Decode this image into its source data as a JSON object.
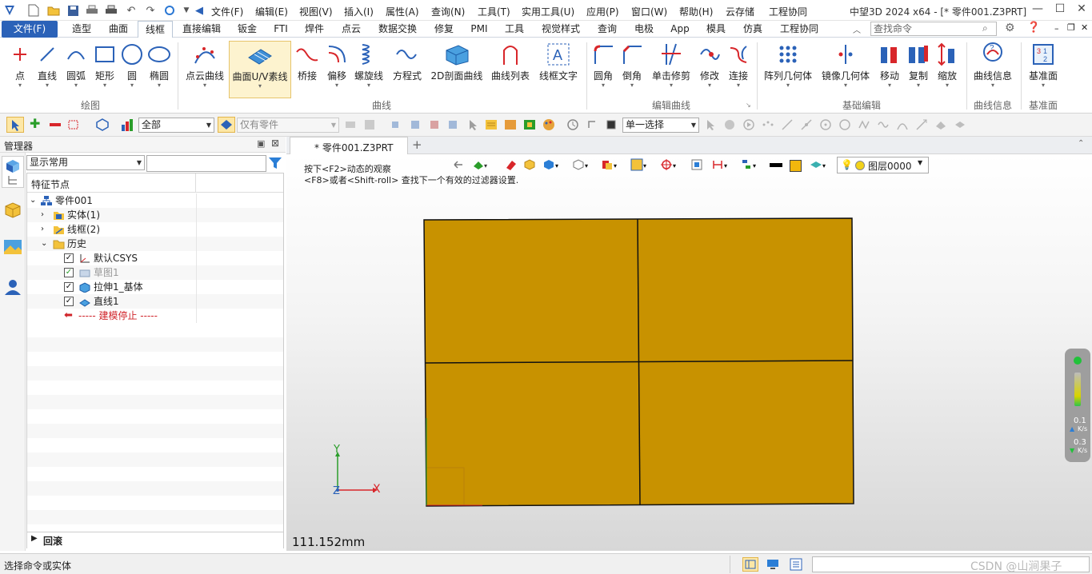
{
  "title": {
    "text": "中望3D 2024 x64 - [* 零件001.Z3PRT]",
    "menu": [
      "文件(F)",
      "编辑(E)",
      "视图(V)",
      "插入(I)",
      "属性(A)",
      "查询(N)",
      "工具(T)",
      "实用工具(U)",
      "应用(P)",
      "窗口(W)",
      "帮助(H)",
      "云存储",
      "工程协同"
    ]
  },
  "tabs": [
    "文件(F)",
    "造型",
    "曲面",
    "线框",
    "直接编辑",
    "钣金",
    "FTI",
    "焊件",
    "点云",
    "数据交换",
    "修复",
    "PMI",
    "工具",
    "视觉样式",
    "查询",
    "电极",
    "App",
    "模具",
    "仿真",
    "工程协同"
  ],
  "search": {
    "placeholder": "查找命令"
  },
  "ribbon": {
    "draw": {
      "group": "绘图",
      "buttons": [
        "点",
        "直线",
        "圆弧",
        "矩形",
        "圆",
        "椭圆"
      ]
    },
    "curve": {
      "group": "曲线",
      "buttons": [
        "点云曲线",
        "曲面U/V素线",
        "桥接",
        "偏移",
        "螺旋线",
        "方程式",
        "2D剖面曲线",
        "曲线列表",
        "线框文字"
      ]
    },
    "edit": {
      "group": "编辑曲线",
      "buttons": [
        "圆角",
        "倒角",
        "单击修剪",
        "修改",
        "连接"
      ]
    },
    "basic": {
      "group": "基础编辑",
      "buttons": [
        "阵列几何体",
        "镜像几何体",
        "移动",
        "复制",
        "缩放"
      ]
    },
    "info": {
      "group": "曲线信息",
      "buttons": [
        "曲线信息"
      ]
    },
    "datum": {
      "group": "基准面",
      "buttons": [
        "基准面"
      ]
    }
  },
  "toolbar2": {
    "filter": "全部",
    "part": "仅有零件",
    "select": "单一选择"
  },
  "manager": {
    "title": "管理器",
    "display": "显示常用",
    "column": "特征节点",
    "tree": [
      {
        "label": "零件001"
      },
      {
        "label": "实体(1)"
      },
      {
        "label": "线框(2)"
      },
      {
        "label": "历史"
      },
      {
        "label": "默认CSYS"
      },
      {
        "label": "草图1"
      },
      {
        "label": "拉伸1_基体"
      },
      {
        "label": "直线1"
      },
      {
        "label": "----- 建模停止 -----"
      }
    ],
    "footer": "回滚"
  },
  "viewtab": {
    "name": "* 零件001.Z3PRT"
  },
  "viewport": {
    "hint1": "按下<F2>动态的观察",
    "hint2": "<F8>或者<Shift-roll> 查找下一个有效的过滤器设置.",
    "layer": "图层0000",
    "scale": "111.152mm",
    "perf1": "0.1",
    "perf1_unit": "K/s",
    "perf2": "0.3",
    "perf2_unit": "K/s",
    "axis_x": "X",
    "axis_y": "Y",
    "axis_z": "Z",
    "part_color": "#C89200"
  },
  "status": {
    "text": "选择命令或实体",
    "watermark": "CSDN @山涧果子"
  }
}
